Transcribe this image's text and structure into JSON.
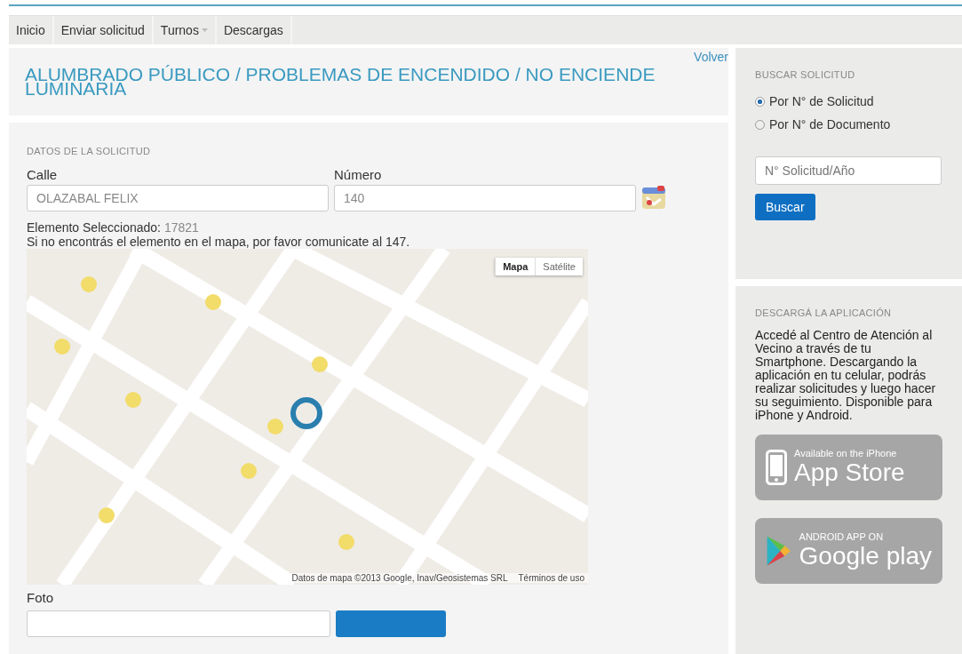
{
  "nav": [
    {
      "label": "Inicio",
      "dropdown": false
    },
    {
      "label": "Enviar solicitud",
      "dropdown": false
    },
    {
      "label": "Turnos",
      "dropdown": true
    },
    {
      "label": "Descargas",
      "dropdown": false
    }
  ],
  "back_link": "Volver",
  "title": "ALUMBRADO PÚBLICO / PROBLEMAS DE ENCENDIDO / NO ENCIENDE LUMINARIA",
  "form": {
    "heading": "DATOS DE LA SOLICITUD",
    "fields": [
      {
        "label": "Calle",
        "value": "OLAZABAL FELIX"
      },
      {
        "label": "Número",
        "value": "140"
      }
    ],
    "selected_label": "Elemento Seleccionado:",
    "selected_value": "17821",
    "help": "Si no encontrás el elemento en el mapa, por favor comunicate al 147.",
    "map": {
      "kind": "picture",
      "types": [
        {
          "label": "Mapa",
          "selected": true
        },
        {
          "label": "Satélite",
          "selected": false
        }
      ],
      "attribution": "Datos de mapa ©2013 Google, Inav/Geosistemas SRL",
      "terms": "Términos de uso"
    },
    "photo_label": "Foto"
  },
  "search": {
    "heading": "BUSCAR SOLICITUD",
    "options": [
      {
        "label": "Por N° de Solicitud",
        "selected": true
      },
      {
        "label": "Por N° de Documento",
        "selected": false
      }
    ],
    "placeholder": "N° Solicitud/Año",
    "button": "Buscar"
  },
  "app": {
    "heading": "DESCARGÁ LA APLICACIÓN",
    "text": "Accedé al Centro de Atención al Vecino a través de tu Smartphone. Descargando la aplicación en tu celular, podrás realizar solicitudes y luego hacer su seguimiento. Disponible para iPhone y Android.",
    "stores": [
      {
        "kind": "apple",
        "small": "Available on the iPhone",
        "big": "App Store"
      },
      {
        "kind": "google",
        "small": "ANDROID APP ON",
        "big": "Google play"
      }
    ]
  }
}
